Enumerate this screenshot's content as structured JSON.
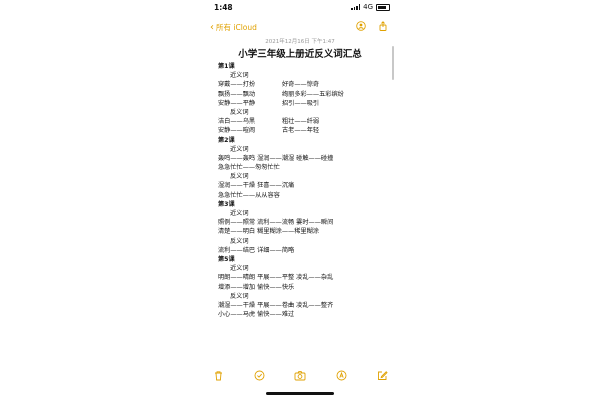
{
  "status": {
    "time": "1:48",
    "network": "4G"
  },
  "nav": {
    "back_label": "所有 iCloud"
  },
  "note": {
    "date": "2021年12月16日 下午1:47",
    "title": "小学三年级上册近反义词汇总",
    "lines": [
      {
        "kind": "heading",
        "a": "第1课",
        "b": ""
      },
      {
        "kind": "sub",
        "a": "近义词",
        "b": ""
      },
      {
        "kind": "pair",
        "a": "穿戴——打扮",
        "b": "好奇——惊奇"
      },
      {
        "kind": "pair",
        "a": "飘扬——飘动",
        "b": "绚丽多彩——五彩缤纷"
      },
      {
        "kind": "pair",
        "a": "安静——平静",
        "b": "招引——吸引"
      },
      {
        "kind": "sub",
        "a": "反义词",
        "b": ""
      },
      {
        "kind": "pair",
        "a": "洁白——乌黑",
        "b": "粗壮——纤弱"
      },
      {
        "kind": "pair",
        "a": "安静——喧闹",
        "b": "古老——年轻"
      },
      {
        "kind": "heading",
        "a": "第2课",
        "b": ""
      },
      {
        "kind": "sub",
        "a": "近义词",
        "b": ""
      },
      {
        "kind": "single",
        "a": "轰鸣——轰鸣 湿润——潮湿 碰触——碰撞",
        "b": ""
      },
      {
        "kind": "single",
        "a": "急急忙忙——匆匆忙忙",
        "b": ""
      },
      {
        "kind": "sub",
        "a": "反义词",
        "b": ""
      },
      {
        "kind": "single",
        "a": "湿润——干燥 狂喜——沉痛",
        "b": ""
      },
      {
        "kind": "single",
        "a": "急急忙忙——从从容容",
        "b": ""
      },
      {
        "kind": "heading",
        "a": "第3课",
        "b": ""
      },
      {
        "kind": "sub",
        "a": "近义词",
        "b": ""
      },
      {
        "kind": "single",
        "a": "照例——照常 流利——流畅 霎时——瞬间",
        "b": ""
      },
      {
        "kind": "single",
        "a": "清楚——明白 糊里糊涂——稀里糊涂",
        "b": ""
      },
      {
        "kind": "sub",
        "a": "反义词",
        "b": ""
      },
      {
        "kind": "single",
        "a": "流利——结巴 详细——简略",
        "b": ""
      },
      {
        "kind": "heading",
        "a": "第5课",
        "b": ""
      },
      {
        "kind": "sub",
        "a": "近义词",
        "b": ""
      },
      {
        "kind": "single",
        "a": "明朗——晴朗 平展——平整 凌乱——杂乱",
        "b": ""
      },
      {
        "kind": "single",
        "a": "增添——增加 愉快——快乐",
        "b": ""
      },
      {
        "kind": "sub",
        "a": "反义词",
        "b": ""
      },
      {
        "kind": "single",
        "a": "潮湿——干燥 平展——卷曲 凌乱——整齐",
        "b": ""
      },
      {
        "kind": "single",
        "a": "小心——马虎 愉快——难过",
        "b": ""
      }
    ]
  },
  "toolbar": {
    "icons": [
      "trash-icon",
      "checklist-icon",
      "camera-icon",
      "markup-icon",
      "compose-icon"
    ]
  },
  "colors": {
    "accent": "#e0a100",
    "text": "#111111",
    "muted": "#999999"
  }
}
